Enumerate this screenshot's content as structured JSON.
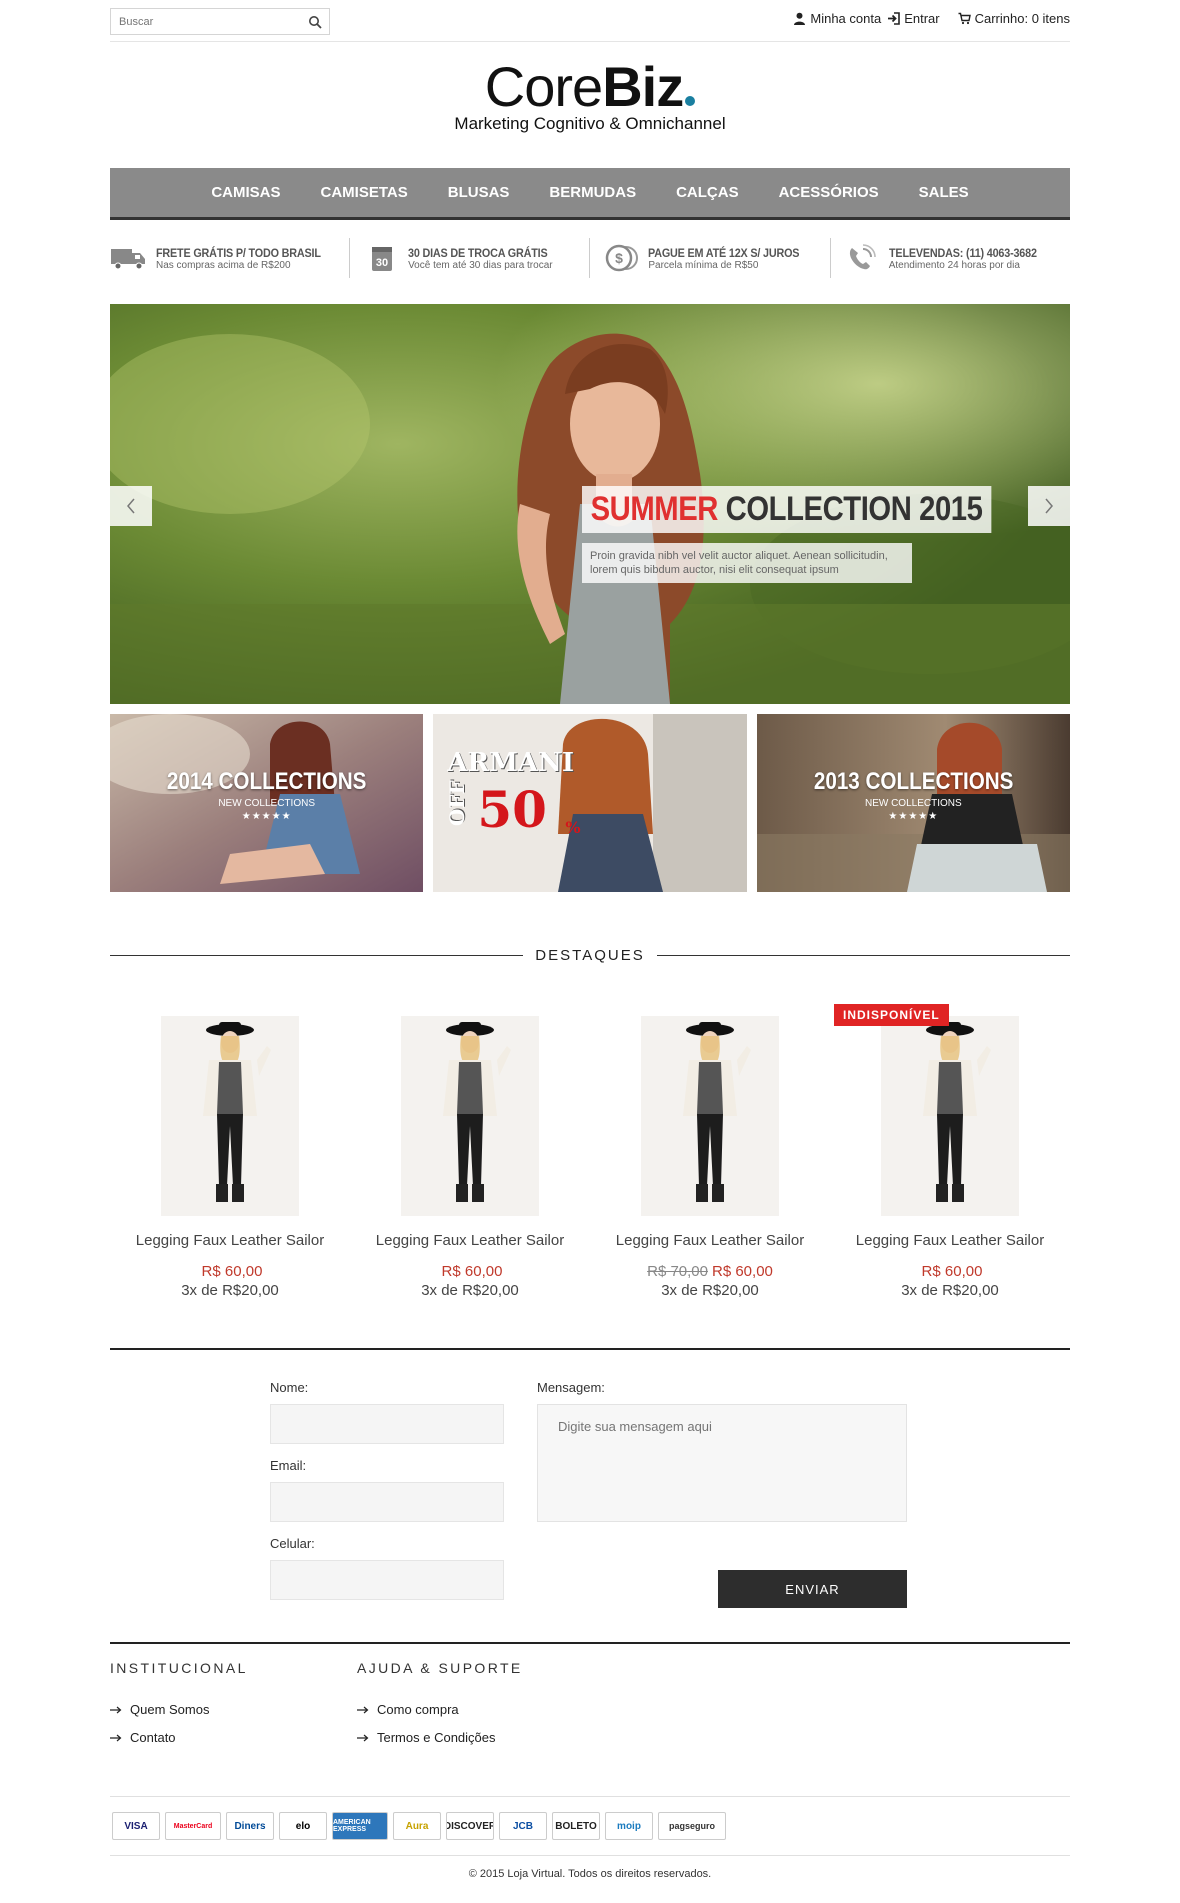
{
  "header": {
    "search_placeholder": "Buscar",
    "my_account": "Minha conta",
    "login": "Entrar",
    "cart": "Carrinho: 0 itens"
  },
  "logo": {
    "brand_light": "Core",
    "brand_bold": "Biz",
    "tagline": "Marketing Cognitivo & Omnichannel",
    "dot_color": "#1a7fa0"
  },
  "nav": {
    "items": [
      "Camisas",
      "Camisetas",
      "Blusas",
      "Bermudas",
      "Calças",
      "Acessórios",
      "Sales"
    ]
  },
  "benefits": [
    {
      "icon": "truck-icon",
      "title": "FRETE GRÁTIS P/ TODO BRASIL",
      "subtitle": "Nas compras acima de R$200"
    },
    {
      "icon": "calendar-30-icon",
      "title": "30 DIAS DE TROCA GRÁTIS",
      "subtitle": "Você tem até 30 dias para trocar"
    },
    {
      "icon": "coins-icon",
      "title": "PAGUE EM ATÉ 12X S/ JUROS",
      "subtitle": "Parcela mínima de R$50"
    },
    {
      "icon": "phone-icon",
      "title": "TELEVENDAS: (11) 4063-3682",
      "subtitle": "Atendimento 24 horas por dia"
    }
  ],
  "hero": {
    "title_accent": "SUMMER",
    "title_rest": "COLLECTION 2015",
    "text": "Proin gravida nibh vel velit auctor aliquet. Aenean sollicitudin, lorem quis bibdum auctor, nisi elit consequat ipsum",
    "accent_color": "#e03030"
  },
  "banners": [
    {
      "title": "2014 COLLECTIONS",
      "subtitle": "NEW COLLECTIONS",
      "stars": "★★★★★"
    },
    {
      "brand": "ARMANI",
      "discount": "50",
      "percent": "%",
      "off": "OFF"
    },
    {
      "title": "2013 COLLECTIONS",
      "subtitle": "NEW COLLECTIONS",
      "stars": "★★★★★"
    }
  ],
  "section_title": "DESTAQUES",
  "products": [
    {
      "name": "Legging Faux Leather Sailor",
      "old_price": "",
      "price": "R$ 60,00",
      "installments": "3x de R$20,00",
      "badge": ""
    },
    {
      "name": "Legging Faux Leather Sailor",
      "old_price": "",
      "price": "R$ 60,00",
      "installments": "3x de R$20,00",
      "badge": ""
    },
    {
      "name": "Legging Faux Leather Sailor",
      "old_price": "R$ 70,00",
      "price": "R$ 60,00",
      "installments": "3x de R$20,00",
      "badge": ""
    },
    {
      "name": "Legging Faux Leather Sailor",
      "old_price": "",
      "price": "R$ 60,00",
      "installments": "3x de R$20,00",
      "badge": "INDISPONÍVEL"
    }
  ],
  "form": {
    "name_label": "Nome:",
    "email_label": "Email:",
    "phone_label": "Celular:",
    "message_label": "Mensagem:",
    "message_placeholder": "Digite sua mensagem aqui",
    "submit": "ENVIAR"
  },
  "footer": {
    "col1_title": "INSTITUCIONAL",
    "col1_links": [
      "Quem Somos",
      "Contato"
    ],
    "col2_title": "AJUDA & SUPORTE",
    "col2_links": [
      "Como compra",
      "Termos e Condições"
    ],
    "payments": [
      "VISA",
      "MasterCard",
      "Diners",
      "elo",
      "AMERICAN EXPRESS",
      "Aura",
      "DISCOVER",
      "JCB",
      "BOLETO",
      "moip",
      "pagseguro"
    ],
    "copyright": "© 2015 Loja Virtual. Todos os direitos reservados."
  }
}
